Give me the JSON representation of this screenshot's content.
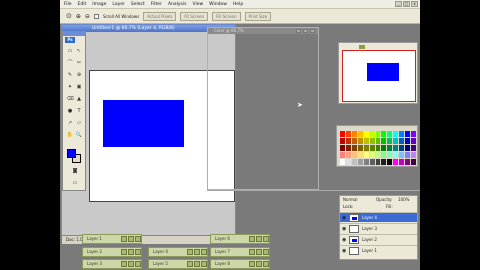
{
  "menubar": {
    "items": [
      "File",
      "Edit",
      "Image",
      "Layer",
      "Select",
      "Filter",
      "Analysis",
      "View",
      "Window",
      "Help"
    ],
    "window_controls": [
      "_",
      "□",
      "x"
    ]
  },
  "optionsbar": {
    "checkbox_label": "Scroll All Windows",
    "buttons": [
      "Actual Pixels",
      "Fit Screen",
      "Fill Screen",
      "Print Size"
    ]
  },
  "toolbox": {
    "logo": "Ps",
    "tools": [
      "▭",
      "↖",
      "⌒",
      "✂",
      "✎",
      "⊕",
      "✦",
      "▣",
      "⌫",
      "▲",
      "●",
      "T",
      "↗",
      "▱",
      "✋",
      "🔍"
    ],
    "foreground_color": "#0000ff",
    "background_color": "#e8d8c8"
  },
  "document": {
    "title": "Untitled-1 @ 66.7% (Layer 4, RGB/8)",
    "status": "Doc: 1.00M/2.82M",
    "shape_color": "#0000ff"
  },
  "ghost_window": {
    "title": "Color @ 66.7%"
  },
  "navigator": {
    "thumb_color": "#0000ff"
  },
  "layers": {
    "blend_mode": "Normal",
    "opacity_label": "Opacity:",
    "opacity_value": "100%",
    "lock_label": "Lock:",
    "fill_label": "Fill:",
    "rows": [
      {
        "name": "Layer 4",
        "selected": true,
        "has_shape": true
      },
      {
        "name": "Layer 3",
        "selected": false,
        "has_shape": false
      },
      {
        "name": "Layer 2",
        "selected": false,
        "has_shape": true
      },
      {
        "name": "Layer 1",
        "selected": false,
        "has_shape": false
      }
    ]
  },
  "minimized_windows": [
    "Layer 1",
    "Layer 2",
    "Layer 3",
    "Layer 4",
    "Layer 5",
    "Layer 6",
    "Layer 7",
    "Layer 8"
  ],
  "swatch_colors": [
    "#ff0000",
    "#ff4000",
    "#ff8000",
    "#ffbf00",
    "#ffff00",
    "#bfff00",
    "#80ff00",
    "#00ff00",
    "#00ff80",
    "#00ffff",
    "#0080ff",
    "#0000ff",
    "#8000ff",
    "#c00000",
    "#c03000",
    "#c06000",
    "#c09000",
    "#c0c000",
    "#90c000",
    "#60c000",
    "#00c000",
    "#00c060",
    "#00c0c0",
    "#0060c0",
    "#0000c0",
    "#6000c0",
    "#800000",
    "#802000",
    "#804000",
    "#806000",
    "#808000",
    "#608000",
    "#408000",
    "#008000",
    "#008040",
    "#008080",
    "#004080",
    "#000080",
    "#400080",
    "#ff8080",
    "#ffa080",
    "#ffc080",
    "#ffe080",
    "#ffff80",
    "#e0ff80",
    "#c0ff80",
    "#80ff80",
    "#80ffc0",
    "#80ffff",
    "#80c0ff",
    "#8080ff",
    "#c080ff",
    "#ffffff",
    "#e0e0e0",
    "#c0c0c0",
    "#a0a0a0",
    "#808080",
    "#606060",
    "#404040",
    "#202020",
    "#000000",
    "#ff00ff",
    "#c000c0",
    "#800080",
    "#400040"
  ]
}
